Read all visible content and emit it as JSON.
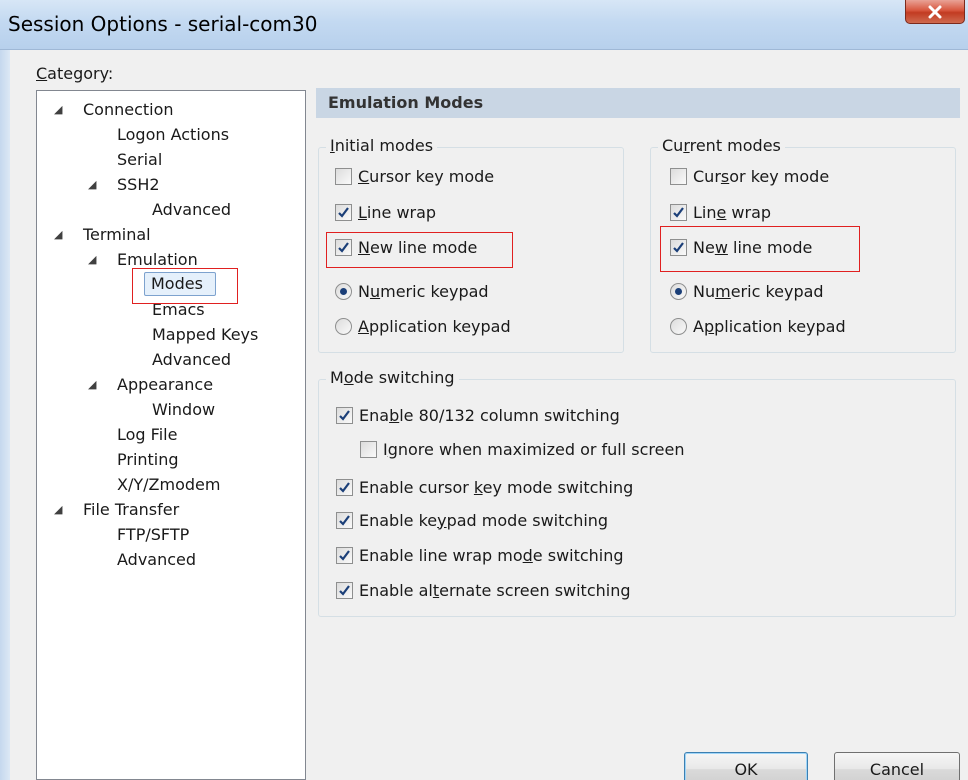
{
  "window": {
    "title": "Session Options - serial-com30",
    "close_glyph": "X"
  },
  "category": {
    "label_pre": "",
    "label_ul": "C",
    "label_post": "ategory:"
  },
  "tree": {
    "connection": "Connection",
    "logon_actions": "Logon Actions",
    "serial": "Serial",
    "ssh2": "SSH2",
    "ssh2_advanced": "Advanced",
    "terminal": "Terminal",
    "emulation": "Emulation",
    "modes": "Modes",
    "emacs": "Emacs",
    "mapped_keys": "Mapped Keys",
    "emulation_advanced": "Advanced",
    "appearance": "Appearance",
    "window": "Window",
    "log_file": "Log File",
    "printing": "Printing",
    "xyz_modem": "X/Y/Zmodem",
    "file_transfer": "File Transfer",
    "ftp_sftp": "FTP/SFTP",
    "ft_advanced": "Advanced",
    "expand_glyph": "◢"
  },
  "panel": {
    "header": "Emulation Modes"
  },
  "initial_modes": {
    "legend": {
      "pre": "",
      "ul": "I",
      "post": "nitial modes"
    },
    "cursor_key": {
      "pre": "",
      "ul": "C",
      "post": "ursor key mode",
      "checked": false
    },
    "line_wrap": {
      "pre": "",
      "ul": "L",
      "post": "ine wrap",
      "checked": true
    },
    "new_line": {
      "pre": "",
      "ul": "N",
      "post": "ew line mode",
      "checked": true
    },
    "numeric_keypad": {
      "pre": "N",
      "ul": "u",
      "post": "meric keypad",
      "selected": true
    },
    "application_keypad": {
      "pre": "",
      "ul": "A",
      "post": "pplication keypad",
      "selected": false
    }
  },
  "current_modes": {
    "legend": {
      "pre": "Cu",
      "ul": "r",
      "post": "rent modes"
    },
    "cursor_key": {
      "pre": "Cur",
      "ul": "s",
      "post": "or key mode",
      "checked": false
    },
    "line_wrap": {
      "pre": "Lin",
      "ul": "e",
      "post": " wrap",
      "checked": true
    },
    "new_line": {
      "pre": "Ne",
      "ul": "w",
      "post": " line mode",
      "checked": true
    },
    "numeric_keypad": {
      "pre": "Nu",
      "ul": "m",
      "post": "eric keypad",
      "selected": true
    },
    "application_keypad": {
      "pre": "A",
      "ul": "p",
      "post": "plication keypad",
      "selected": false
    }
  },
  "mode_switching": {
    "legend": {
      "pre": "M",
      "ul": "o",
      "post": "de switching"
    },
    "enable_80_132": {
      "pre": "Ena",
      "ul": "b",
      "post": "le 80/132 column switching",
      "checked": true
    },
    "ignore_maximized": {
      "pre": "I",
      "ul": "g",
      "post": "nore when maximized or full screen",
      "checked": false
    },
    "cursor_key_switching": {
      "pre": "Enable cursor ",
      "ul": "k",
      "post": "ey mode switching",
      "checked": true
    },
    "keypad_switching": {
      "pre": "Enable ke",
      "ul": "y",
      "post": "pad mode switching",
      "checked": true
    },
    "line_wrap_switching": {
      "pre": "Enable line wrap mo",
      "ul": "d",
      "post": "e switching",
      "checked": true
    },
    "alternate_screen": {
      "pre": "Enable al",
      "ul": "t",
      "post": "ernate screen switching",
      "checked": true
    }
  },
  "buttons": {
    "ok": "OK",
    "cancel": "Cancel"
  },
  "colors": {
    "highlight_box": "#e02020",
    "header_bg": "#c9d6e4",
    "selection_bg": "#e5f0fb",
    "check_color": "#1b3f78"
  }
}
